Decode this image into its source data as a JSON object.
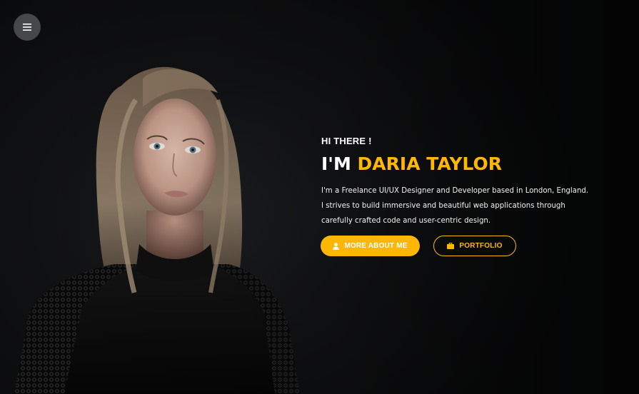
{
  "nav": {
    "menu_icon": "hamburger-icon"
  },
  "hero": {
    "greeting": "HI THERE !",
    "headline_prefix": "I'M ",
    "name": "DARIA TAYLOR",
    "bio_lines": [
      "I'm a Freelance UI/UX Designer and Developer based in London, England.",
      "I strives to build immersive and beautiful web applications through",
      "carefully crafted code and user-centric design."
    ]
  },
  "actions": {
    "about_label": "MORE ABOUT ME",
    "about_icon": "user-icon",
    "portfolio_label": "PORTFOLIO",
    "portfolio_icon": "briefcase-icon"
  },
  "colors": {
    "accent": "#ffb703",
    "background": "#0b0c0e",
    "menu_button": "#45474a"
  }
}
